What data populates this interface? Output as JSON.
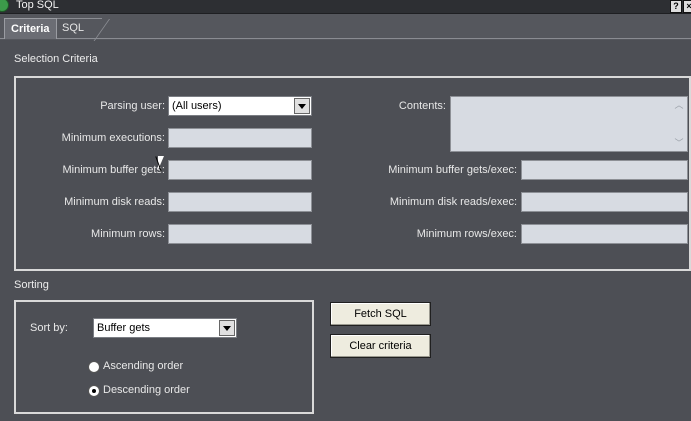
{
  "window": {
    "title": "Top SQL"
  },
  "tabs": [
    {
      "label": "Criteria",
      "active": true
    },
    {
      "label": "SQL",
      "active": false
    }
  ],
  "selection": {
    "section_label": "Selection Criteria",
    "parsing_user": {
      "label": "Parsing user:",
      "value": "(All users)"
    },
    "min_executions": {
      "label": "Minimum executions:",
      "value": ""
    },
    "min_buffer_gets": {
      "label": "Minimum buffer gets:",
      "value": ""
    },
    "min_disk_reads": {
      "label": "Minimum disk reads:",
      "value": ""
    },
    "min_rows": {
      "label": "Minimum rows:",
      "value": ""
    },
    "contents": {
      "label": "Contents:",
      "value": ""
    },
    "min_buffer_gets_exec": {
      "label": "Minimum buffer gets/exec:",
      "value": ""
    },
    "min_disk_reads_exec": {
      "label": "Minimum disk reads/exec:",
      "value": ""
    },
    "min_rows_exec": {
      "label": "Minimum rows/exec:",
      "value": ""
    }
  },
  "sorting": {
    "section_label": "Sorting",
    "sort_by": {
      "label": "Sort by:",
      "value": "Buffer gets"
    },
    "ascending": {
      "label": "Ascending order",
      "checked": false
    },
    "descending": {
      "label": "Descending order",
      "checked": true
    }
  },
  "actions": {
    "fetch_sql": "Fetch SQL",
    "clear_criteria": "Clear criteria"
  },
  "colors": {
    "background": "#4d4f55",
    "field": "#d7dbe2",
    "button": "#eeecdf",
    "group_border": "#d9d9d9"
  }
}
